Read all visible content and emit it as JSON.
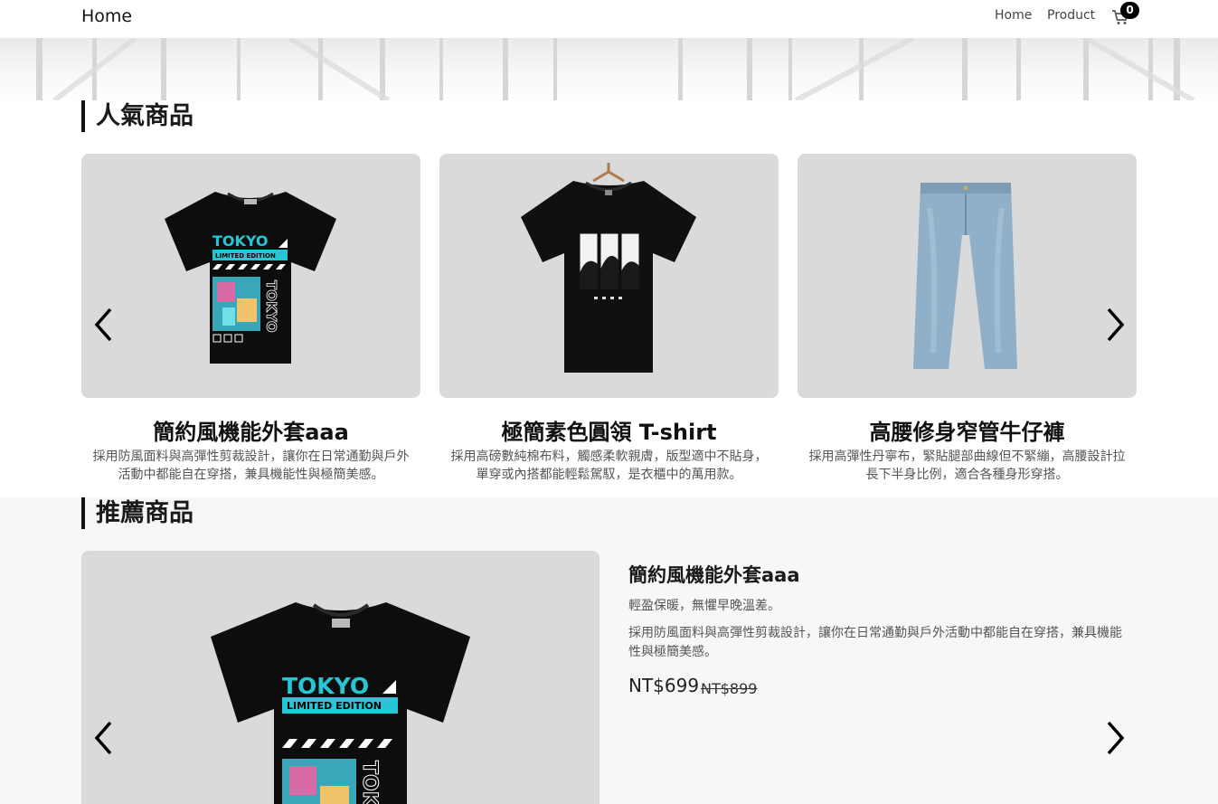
{
  "nav": {
    "brand": "Home",
    "links": [
      "Home",
      "Product"
    ],
    "cart_count": "0",
    "cart_icon": "shopping-cart-icon"
  },
  "popular": {
    "heading": "人氣商品",
    "products": [
      {
        "name": "簡約風機能外套aaa",
        "desc": "採用防風面料與高彈性剪裁設計，讓你在日常通勤與戶外活動中都能自在穿搭，兼具機能性與極簡美感。",
        "print_text": [
          "TOKYO",
          "LIMITED EDITION",
          "TOKYO"
        ]
      },
      {
        "name": "極簡素色圓領 T-shirt",
        "desc": "採用高磅數純棉布料，觸感柔軟親膚，版型適中不貼身，單穿或內搭都能輕鬆駕馭，是衣櫃中的萬用款。"
      },
      {
        "name": "高腰修身窄管牛仔褲",
        "desc": "採用高彈性丹寧布，緊貼腿部曲線但不緊繃，高腰設計拉長下半身比例，適合各種身形穿搭。"
      }
    ],
    "prev_icon": "chevron-left-icon",
    "next_icon": "chevron-right-icon"
  },
  "recommended": {
    "heading": "推薦商品",
    "product": {
      "name": "簡約風機能外套aaa",
      "subtitle": "輕盈保暖，無懼早晚溫差。",
      "desc": "採用防風面料與高彈性剪裁設計，讓你在日常通勤與戶外活動中都能自在穿搭，兼具機能性與極簡美感。",
      "price": "NT$699",
      "original_price": "NT$899",
      "print_text": [
        "TOKYO",
        "LIMITED EDITION",
        "TOKYO"
      ]
    }
  },
  "colors": {
    "card_bg": "#dadada",
    "tee_black": "#0d0d0d",
    "accent_cyan": "#25c6d6",
    "denim": "#8fb0c8",
    "section_bg": "#f6f7f9"
  }
}
